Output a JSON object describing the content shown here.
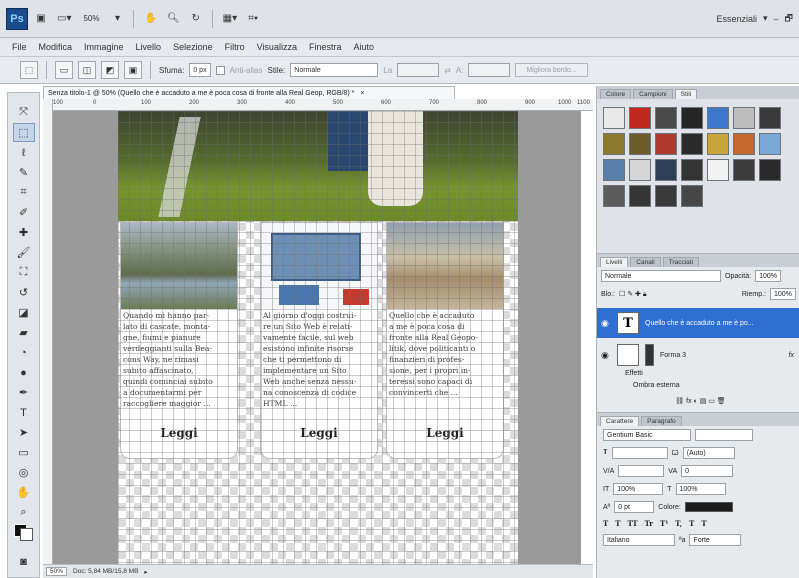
{
  "app": {
    "logo": "Ps",
    "zoom": "50%",
    "workspace": "Essenziali",
    "window_controls": [
      "–",
      "🗗"
    ]
  },
  "menu": [
    "File",
    "Modifica",
    "Immagine",
    "Livello",
    "Selezione",
    "Filtro",
    "Visualizza",
    "Finestra",
    "Aiuto"
  ],
  "options": {
    "feather_label": "Sfuma:",
    "feather_value": "0 px",
    "antialias_label": "Anti-alias",
    "style_label": "Stile:",
    "style_value": "Normale",
    "width_label": "La",
    "height_label": "A:",
    "refine_button": "Migliora bordo..."
  },
  "document": {
    "tab_title": "Senza titolo-1 @ 50% (Quello che è accaduto a me è poca cosa di fronte alla Real Geop, RGB/8) *",
    "tab_close": "×",
    "ruler_marks": [
      "100",
      "0",
      "100",
      "200",
      "300",
      "400",
      "500",
      "600",
      "700",
      "800",
      "900",
      "1000",
      "1100"
    ]
  },
  "cards": [
    {
      "text": "Quando mi hanno par-\nlato di cascate, monta-\ngne, fiumi e pianure\nverdeggianti sulla Bea-\ncons Way, ne rimasi\nsubito affascinato,\nquindi cominciai subito\na documentarmi per\nraccogliere maggior ...",
      "button": "Leggi"
    },
    {
      "text": "Al giorno d'oggi costrui-\nre un Sito Web è relati-\nvamente facile, sul web\nesistono infinite risorse\nche ti permettono di\nimplementare un Sito\nWeb anche senza nessu-\nna conoscenza di codice\nHTML ...",
      "button": "Leggi"
    },
    {
      "text": "Quello che è accaduto\na me è poca cosa di\nfronte alla Real Geopo-\nlitik, dove politicanti o\nfinanzieri di profes-\nsione, per i propri in-\nteressi sono capaci di\nconvincerti che ...",
      "button": "Leggi"
    }
  ],
  "panels": {
    "top_tabs": [
      "Colore",
      "Campioni",
      "Stili"
    ],
    "style_colors": [
      "#e9e9e9",
      "#c0281f",
      "#4a4a4a",
      "#262626",
      "#3c77c9",
      "#bdbdbd",
      "#3a3a3a",
      "#8c7b2e",
      "#6b5a2a",
      "#b03a2e",
      "#2b2b2b",
      "#c9a43a",
      "#c56b2d",
      "#7aa8d8",
      "#5a7fa8",
      "#d5d5d5",
      "#2d3e57",
      "#333333",
      "#f2f2f2",
      "#3b3b3b",
      "#2a2a2a",
      "#5c5c5c",
      "#353535",
      "#3a3a3a",
      "#474747"
    ],
    "layers_tabs": [
      "Livelli",
      "Canali",
      "Tracciati"
    ],
    "blend_mode": "Normale",
    "opacity_label": "Opacità:",
    "opacity_value": "100%",
    "lock_label": "Blo.:",
    "fill_label": "Riemp.:",
    "fill_value": "100%",
    "layers": [
      {
        "name": "Quello che è accaduto a me è po...",
        "thumb": "T",
        "selected": true
      },
      {
        "name": "Forma 3",
        "fx": "fx",
        "selected": false
      }
    ],
    "effects_label": "Effetti",
    "effect_item": "Ombra esterna",
    "char_tabs": [
      "Carattere",
      "Paragrafo"
    ],
    "font_family": "Gentium Basic",
    "leading": "(Auto)",
    "tracking": "0",
    "vscale": "100%",
    "hscale": "100%",
    "baseline": "0 pt",
    "color_label": "Colore:",
    "text_buttons": [
      "T",
      "T",
      "TT",
      "Tr",
      "T¹",
      "T,",
      "T",
      "T"
    ],
    "language": "Italiano",
    "aa_label": "ªa",
    "aa_value": "Forte"
  },
  "status": {
    "zoom": "50%",
    "doc": "Doc: 5,84 MB/15,8 MB"
  }
}
